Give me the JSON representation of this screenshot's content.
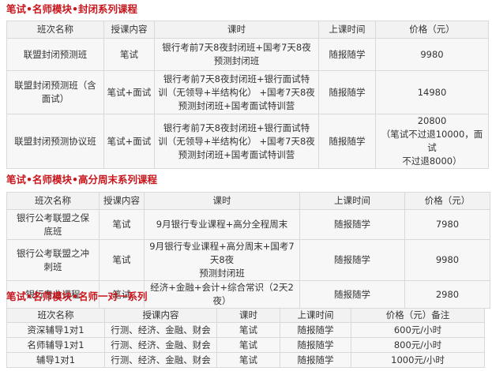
{
  "sections": [
    {
      "title": "笔试•名师模块•封闭系列课程",
      "headers": [
        "班次名称",
        "授课内容",
        "课时",
        "上课时间",
        "价格（元）"
      ],
      "rows": [
        {
          "name": [
            "联盟封闭预测班"
          ],
          "content": [
            "笔试"
          ],
          "hours": [
            "银行考前7天8夜封闭班+国考7天8夜",
            "预测封闭班"
          ],
          "time": [
            "随报随学"
          ],
          "price": [
            "9980"
          ]
        },
        {
          "name": [
            "联盟封闭预测班（含",
            "面试）"
          ],
          "content": [
            "笔试+面试"
          ],
          "hours": [
            "银行考前7天8夜封闭班+银行面试特",
            "训（无领导+半结构化） +国考7天8夜",
            "预测封闭班+国考面试特训营"
          ],
          "time": [
            "随报随学"
          ],
          "price": [
            "14980"
          ]
        },
        {
          "name": [
            "联盟封闭预测协议班"
          ],
          "content": [
            "笔试+面试"
          ],
          "hours": [
            "银行考前7天8夜封闭班+银行面试特",
            "训（无领导+半结构化） +国考7天8夜",
            "预测封闭班+国考面试特训营"
          ],
          "time": [
            "随报随学"
          ],
          "price": [
            "20800",
            "（笔试不过退10000，面试",
            "不过退8000）"
          ]
        }
      ]
    },
    {
      "title": "笔试•名师模块•高分周末系列课程",
      "headers": [
        "班次名称",
        "授课内容",
        "课时",
        "上课时间",
        "价格（元）"
      ],
      "rows": [
        {
          "name": [
            "银行公考联盟之保",
            "底班"
          ],
          "content": [
            "笔试"
          ],
          "hours": [
            "9月银行专业课程+高分全程周末"
          ],
          "time": [
            "随报随学"
          ],
          "price": [
            "7980"
          ]
        },
        {
          "name": [
            "银行公考联盟之冲",
            "刺班"
          ],
          "content": [
            "笔试"
          ],
          "hours": [
            "9月银行专业课程+高分周末+国考7天8夜",
            "预测封闭班"
          ],
          "time": [
            "随报随学"
          ],
          "price": [
            "9980"
          ]
        },
        {
          "name": [
            "银行专业课程"
          ],
          "content": [
            "笔试"
          ],
          "hours": [
            "经济+金融+会计+综合常识（2天2夜）"
          ],
          "time": [
            "随报随学"
          ],
          "price": [
            "2980"
          ]
        }
      ]
    },
    {
      "title": "笔试•名师模块•名师一对一系列",
      "headers": [
        "班次名称",
        "授课内容",
        "课时",
        "上课时间",
        "价格（元）备注"
      ],
      "rows": [
        {
          "name": "资深辅导1对1",
          "content": "行测、经济、金融、财会",
          "hours": "笔试",
          "time": "随报随学",
          "price": "600元/小时"
        },
        {
          "name": "名师辅导1对1",
          "content": "行测、经济、金融、财会",
          "hours": "笔试",
          "time": "随报随学",
          "price": "800元/小时"
        },
        {
          "name": "辅导1对1",
          "content": "行测、经济、金融、财会",
          "hours": "笔试",
          "time": "随报随学",
          "price": "1000元/小时"
        }
      ]
    }
  ]
}
